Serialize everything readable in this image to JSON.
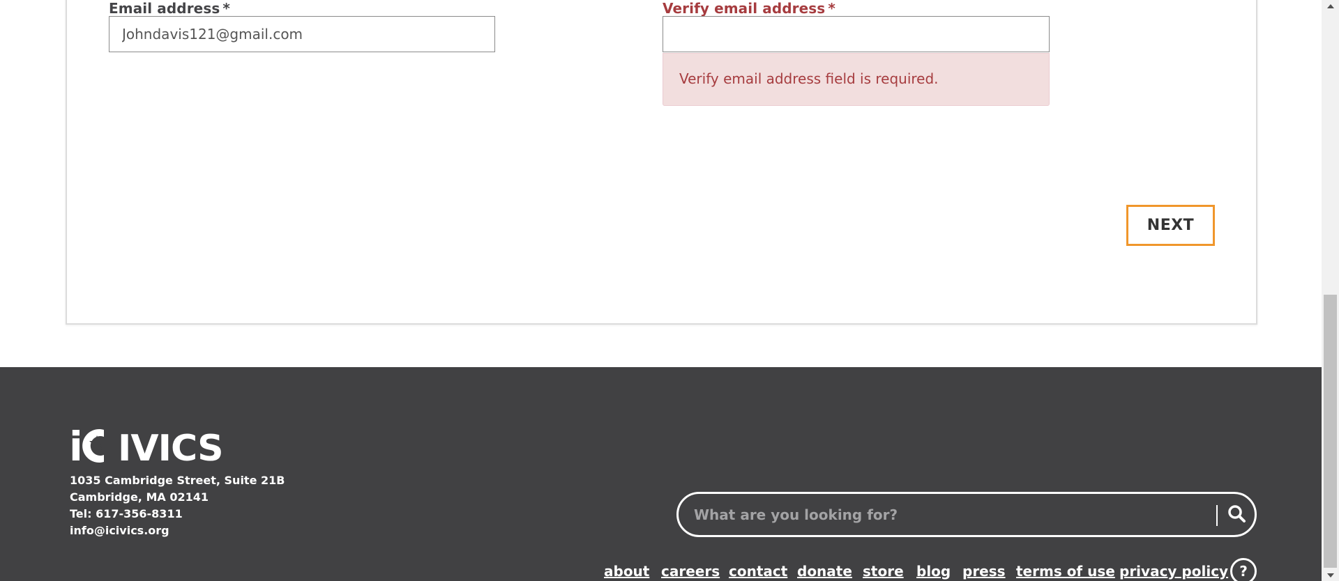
{
  "form": {
    "email_label": "Email address",
    "email_required_mark": "*",
    "email_value": "Johndavis121@gmail.com",
    "verify_label": "Verify email address",
    "verify_required_mark": "*",
    "verify_value": "",
    "verify_error": "Verify email address field is required.",
    "next_label": "NEXT"
  },
  "footer": {
    "logo_text": "iCivics",
    "address_line1": "1035 Cambridge Street, Suite 21B",
    "address_line2": "Cambridge, MA 02141",
    "phone": "Tel: 617-356-8311",
    "email": "info@icivics.org",
    "search_placeholder": "What are you looking for?",
    "nav": [
      {
        "label": "about"
      },
      {
        "label": "careers"
      },
      {
        "label": "contact"
      },
      {
        "label": "donate"
      },
      {
        "label": "store"
      },
      {
        "label": "blog"
      },
      {
        "label": "press"
      },
      {
        "label": "terms of use"
      },
      {
        "label": "privacy policy"
      }
    ],
    "help_label": "?"
  },
  "colors": {
    "footer_bg": "#414143",
    "error_text": "#a63c3f",
    "error_bg": "#f2dede",
    "next_border": "#f0962b"
  },
  "icons": {
    "search": "search-icon",
    "help": "help-icon",
    "scroll_up": "chevron-up-icon",
    "scroll_down": "chevron-down-icon"
  }
}
